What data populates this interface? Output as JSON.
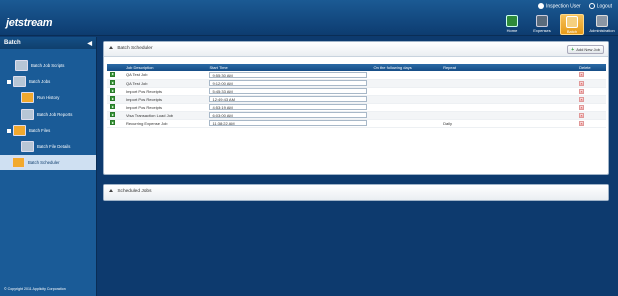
{
  "header": {
    "logo_text": "jetstream",
    "user_name": "Inspection User",
    "logout_label": "Logout",
    "nav": [
      {
        "label": "Home",
        "icon": "home-icon"
      },
      {
        "label": "Expenses",
        "icon": "expenses-icon"
      },
      {
        "label": "Batch",
        "icon": "batch-icon",
        "active": true
      },
      {
        "label": "Administration",
        "icon": "admin-icon"
      }
    ]
  },
  "sidebar": {
    "title": "Batch",
    "items": [
      {
        "label": "Batch Job Scripts"
      },
      {
        "label": "Batch Jobs"
      },
      {
        "label": "Run History"
      },
      {
        "label": "Batch Job Reports"
      },
      {
        "label": "Batch Files"
      },
      {
        "label": "Batch File Details"
      },
      {
        "label": "Batch Scheduler",
        "selected": true
      }
    ],
    "copyright": "© Copyright 2011 Applicity Corporation"
  },
  "scheduler": {
    "title": "Batch Scheduler",
    "add_button": "Add New Job",
    "columns": [
      "Job Description",
      "Start Time",
      "On the following days",
      "Repeat",
      "Delete"
    ],
    "rows": [
      {
        "desc": "QA Test Job",
        "time": "9:55:30 AM",
        "days": "",
        "repeat": ""
      },
      {
        "desc": "QA Test Job",
        "time": "9:12:00 AM",
        "days": "",
        "repeat": ""
      },
      {
        "desc": "Import Pos Receipts",
        "time": "5:45:33 AM",
        "days": "",
        "repeat": ""
      },
      {
        "desc": "Import Pos Receipts",
        "time": "12:49:43 AM",
        "days": "",
        "repeat": ""
      },
      {
        "desc": "Import Pos Receipts",
        "time": "4:53:19 AM",
        "days": "",
        "repeat": ""
      },
      {
        "desc": "Visa Transaction Load Job",
        "time": "6:03:00 AM",
        "days": "",
        "repeat": ""
      },
      {
        "desc": "Recurring Expense Job",
        "time": "11:38:22 AM",
        "days": "",
        "repeat": "Daily"
      }
    ]
  },
  "scheduled_jobs": {
    "title": "Scheduled Jobs"
  },
  "colors": {
    "header_bg": "#0d3c70",
    "sidebar_bg": "#1a5b97",
    "table_header": "#154d86",
    "active_nav": "#e79a18"
  }
}
